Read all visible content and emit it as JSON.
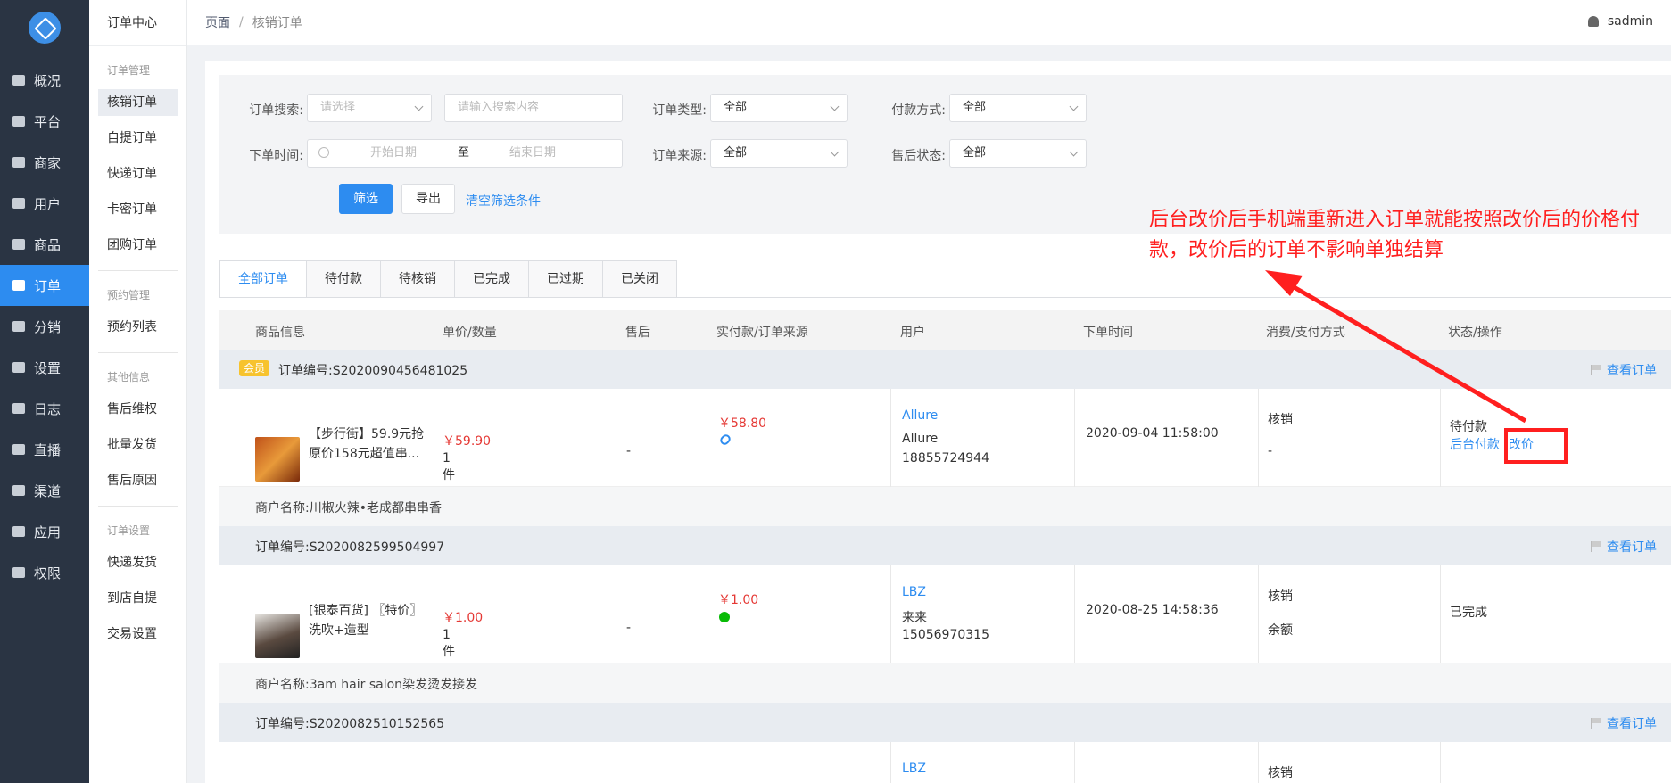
{
  "sidebar": {
    "items": [
      {
        "label": "概况",
        "icon": "dashboard-icon"
      },
      {
        "label": "平台",
        "icon": "monitor-icon"
      },
      {
        "label": "商家",
        "icon": "store-icon"
      },
      {
        "label": "用户",
        "icon": "user-icon"
      },
      {
        "label": "商品",
        "icon": "goods-icon"
      },
      {
        "label": "订单",
        "icon": "order-icon",
        "active": true
      },
      {
        "label": "分销",
        "icon": "distribution-icon"
      },
      {
        "label": "设置",
        "icon": "gear-icon"
      },
      {
        "label": "日志",
        "icon": "log-icon"
      },
      {
        "label": "直播",
        "icon": "live-icon"
      },
      {
        "label": "渠道",
        "icon": "channel-icon"
      },
      {
        "label": "应用",
        "icon": "apps-icon"
      },
      {
        "label": "权限",
        "icon": "lock-icon"
      }
    ]
  },
  "submenu": {
    "title": "订单中心",
    "group1": "订单管理",
    "items1": [
      "核销订单",
      "自提订单",
      "快递订单",
      "卡密订单",
      "团购订单"
    ],
    "group2": "预约管理",
    "items2": [
      "预约列表"
    ],
    "group3": "其他信息",
    "items3": [
      "售后维权",
      "批量发货",
      "售后原因"
    ],
    "group4": "订单设置",
    "items4": [
      "快递发货",
      "到店自提",
      "交易设置"
    ]
  },
  "header": {
    "crumb1": "页面",
    "crumb_sep": "/",
    "crumb2": "核销订单",
    "username": "sadmin"
  },
  "filters": {
    "search_label": "订单搜索:",
    "search_select_placeholder": "请选择",
    "search_input_placeholder": "请输入搜索内容",
    "type_label": "订单类型:",
    "type_value": "全部",
    "pay_label": "付款方式:",
    "pay_value": "全部",
    "time_label": "下单时间:",
    "start_placeholder": "开始日期",
    "to": "至",
    "end_placeholder": "结束日期",
    "source_label": "订单来源:",
    "source_value": "全部",
    "after_label": "售后状态:",
    "after_value": "全部",
    "filter_btn": "筛选",
    "export_btn": "导出",
    "clear_link": "清空筛选条件"
  },
  "tabs": [
    "全部订单",
    "待付款",
    "待核销",
    "已完成",
    "已过期",
    "已关闭"
  ],
  "table": {
    "headers": [
      "商品信息",
      "单价/数量",
      "售后",
      "实付款/订单来源",
      "用户",
      "下单时间",
      "消费/支付方式",
      "状态/操作"
    ],
    "view_order": "查看订单",
    "orders": [
      {
        "badge": "会员",
        "order_no": "订单编号:S2020090456481025",
        "product_line1": "【步行街】59.9元抢",
        "product_line2": "原价158元超值串...",
        "price": "￥59.90",
        "qty": "1件",
        "after_sale": "-",
        "paid": "￥58.80",
        "user_name": "Allure",
        "user_nick": "Allure",
        "user_phone": "18855724944",
        "time": "2020-09-04 11:58:00",
        "consume": "核销",
        "pay_method": "-",
        "status": "待付款",
        "action1": "后台付款",
        "action2": "改价",
        "merchant": "商户名称:川椒火辣•老成都串串香"
      },
      {
        "order_no": "订单编号:S2020082599504997",
        "product_line1": "[银泰百货] 〖特价〗",
        "product_line2": "洗吹+造型",
        "price": "￥1.00",
        "qty": "1件",
        "after_sale": "-",
        "paid": "￥1.00",
        "user_name": "LBZ",
        "user_nick": "来来",
        "user_phone": "15056970315",
        "time": "2020-08-25 14:58:36",
        "consume": "核销",
        "pay_method": "余额",
        "status": "已完成",
        "merchant": "商户名称:3am hair salon染发烫发接发"
      },
      {
        "order_no": "订单编号:S2020082510152565",
        "user_name": "LBZ",
        "consume": "核销"
      }
    ]
  },
  "annotation": {
    "text": "后台改价后手机端重新进入订单就能按照改价后的价格付款，改价后的订单不影响单独结算",
    "color": "#ff1f1f"
  },
  "colors": {
    "accent": "#2d8cf0",
    "sidebar_bg": "#2a3443",
    "price": "#e53935",
    "badge": "#f7c32e"
  }
}
